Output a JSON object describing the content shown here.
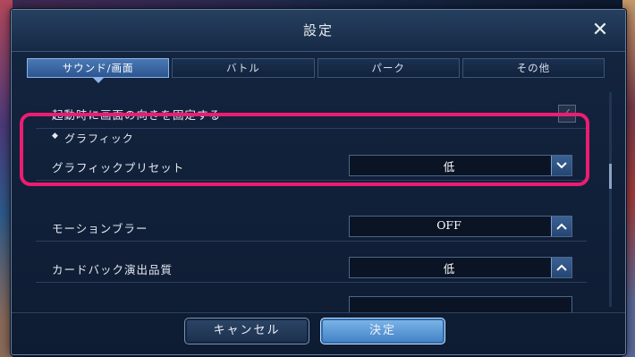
{
  "dialog": {
    "title": "設定",
    "close_icon": "close-icon"
  },
  "tabs": [
    {
      "label": "サウンド/画面",
      "active": true
    },
    {
      "label": "バトル",
      "active": false
    },
    {
      "label": "パーク",
      "active": false
    },
    {
      "label": "その他",
      "active": false
    }
  ],
  "settings": {
    "orientation_lock": {
      "label": "起動時に画面の向きを固定する",
      "checked": true
    },
    "graphics_section": {
      "label": "グラフィック"
    },
    "graphics_preset": {
      "label": "グラフィックプリセット",
      "value": "低",
      "arrow": "chevron-down-icon"
    },
    "motion_blur": {
      "label": "モーションブラー",
      "value": "OFF",
      "arrow": "chevron-up-icon"
    },
    "card_back": {
      "label": "カードバック演出品質",
      "value": "低",
      "arrow": "chevron-up-icon"
    }
  },
  "footer": {
    "cancel_label": "キャンセル",
    "ok_label": "決定"
  },
  "colors": {
    "highlight": "#ec1c72",
    "tab_active": "#3f6aa6",
    "ok_button": "#5a9ad6"
  }
}
